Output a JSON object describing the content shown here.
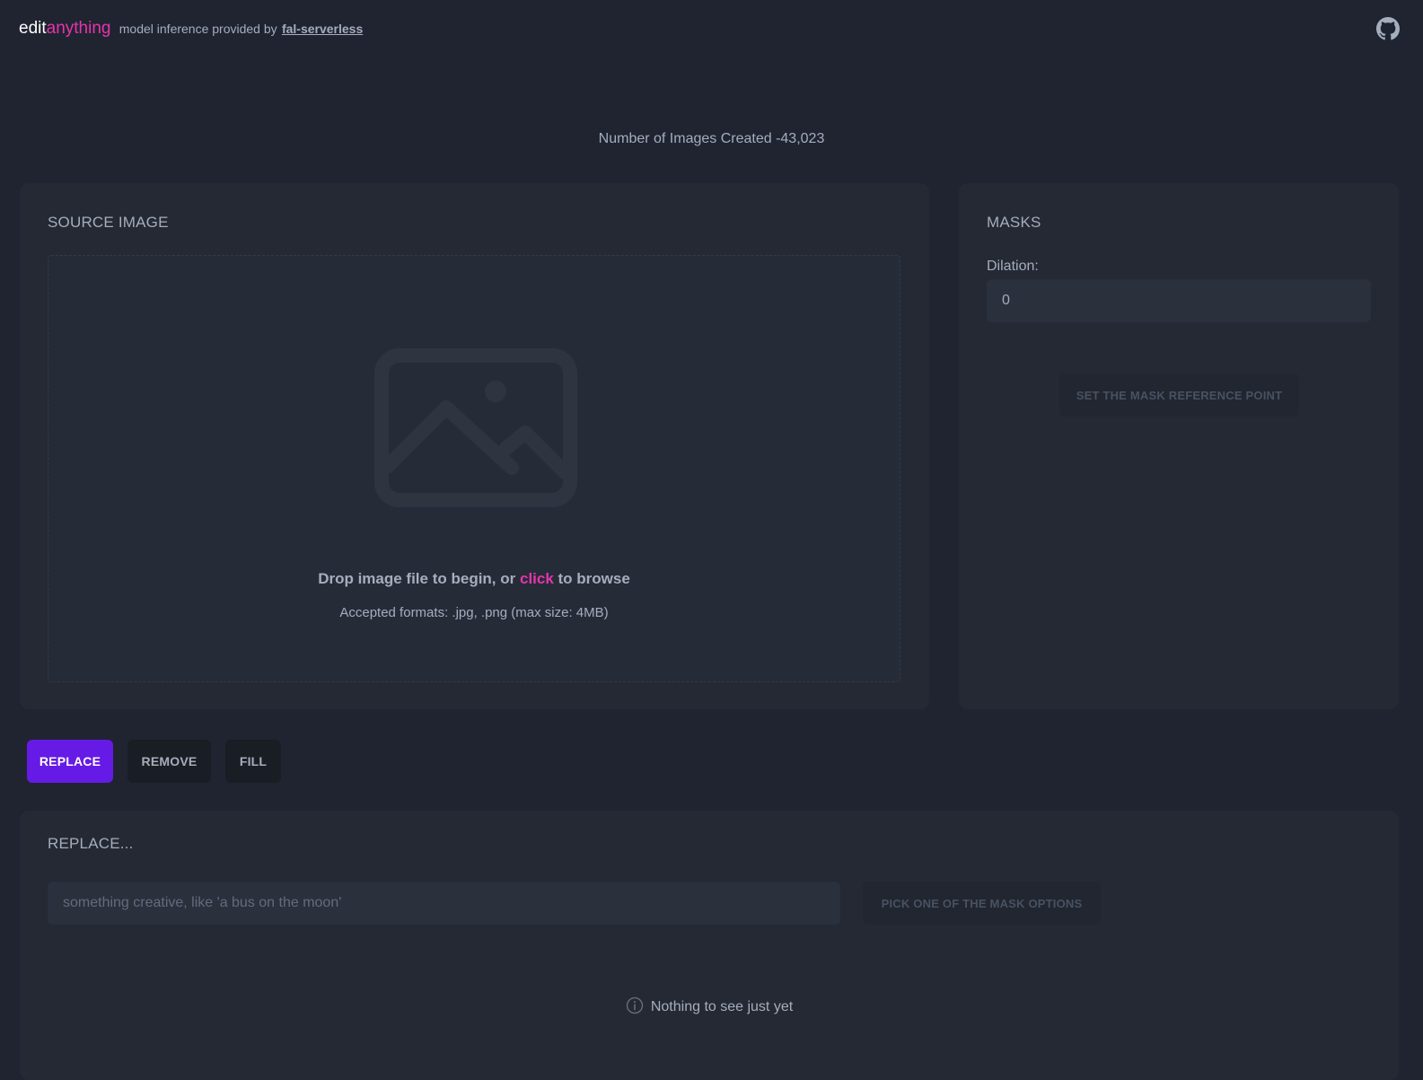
{
  "header": {
    "brand_edit": "edit",
    "brand_anything": "anything",
    "tagline": "model inference provided by",
    "provider_link": "fal-serverless",
    "github_icon": "github-icon"
  },
  "counter": {
    "text": "Number of Images Created -43,023"
  },
  "source": {
    "title": "SOURCE IMAGE",
    "image_icon": "image-placeholder-icon",
    "drop_prefix": "Drop image file to begin, or ",
    "drop_link": "click",
    "drop_suffix": " to browse",
    "formats": "Accepted formats: .jpg, .png (max size: 4MB)"
  },
  "masks": {
    "title": "MASKS",
    "dilation_label": "Dilation:",
    "dilation_value": "0",
    "reference_button": "SET THE MASK REFERENCE POINT"
  },
  "modes": {
    "replace": "REPLACE",
    "remove": "REMOVE",
    "fill": "FILL",
    "active": "replace"
  },
  "replace_panel": {
    "title": "REPLACE...",
    "prompt_placeholder": "something creative, like 'a bus on the moon'",
    "pick_button": "PICK ONE OF THE MASK OPTIONS",
    "empty_text": "Nothing to see just yet",
    "empty_icon": "info-icon"
  },
  "colors": {
    "background": "#1f2430",
    "card": "#242933",
    "accent_pink": "#e535ab",
    "primary_purple": "#661ae6",
    "text": "#a6adbb"
  }
}
